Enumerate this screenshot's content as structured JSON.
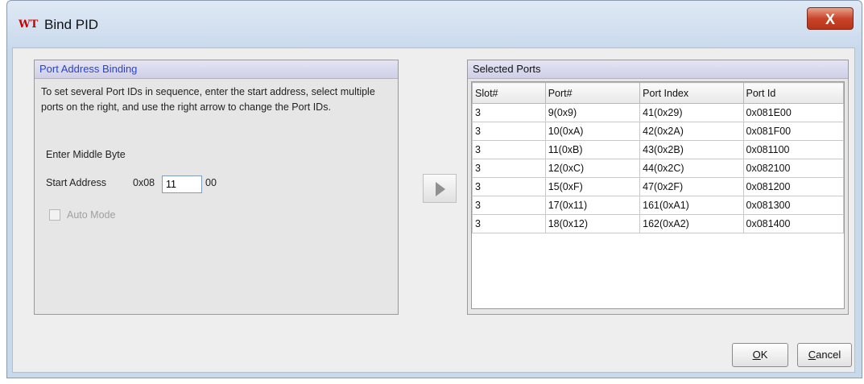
{
  "window": {
    "logo": "WT",
    "title": "Bind PID",
    "close_glyph": "X"
  },
  "left_panel": {
    "title": "Port Address Binding",
    "description": "To set several Port IDs in sequence, enter the start address, select multiple ports on the right, and use the right arrow to change the Port IDs.",
    "middle_byte_label": "Enter Middle Byte",
    "start_address_label": "Start Address",
    "start_address_prefix": "0x08",
    "start_address_value": "11",
    "start_address_suffix": "00",
    "auto_mode_label": "Auto Mode",
    "auto_mode_checked": false
  },
  "arrow_button": {
    "icon": "right-arrow-icon"
  },
  "right_panel": {
    "title": "Selected Ports",
    "columns": [
      "Slot#",
      "Port#",
      "Port Index",
      "Port Id"
    ],
    "rows": [
      [
        "3",
        "9(0x9)",
        "41(0x29)",
        "0x081E00"
      ],
      [
        "3",
        "10(0xA)",
        "42(0x2A)",
        "0x081F00"
      ],
      [
        "3",
        "11(0xB)",
        "43(0x2B)",
        "0x081100"
      ],
      [
        "3",
        "12(0xC)",
        "44(0x2C)",
        "0x082100"
      ],
      [
        "3",
        "15(0xF)",
        "47(0x2F)",
        "0x081200"
      ],
      [
        "3",
        "17(0x11)",
        "161(0xA1)",
        "0x081300"
      ],
      [
        "3",
        "18(0x12)",
        "162(0xA2)",
        "0x081400"
      ]
    ]
  },
  "buttons": {
    "ok_mnemonic": "O",
    "ok_rest": "K",
    "cancel_mnemonic": "C",
    "cancel_rest": "ancel"
  }
}
